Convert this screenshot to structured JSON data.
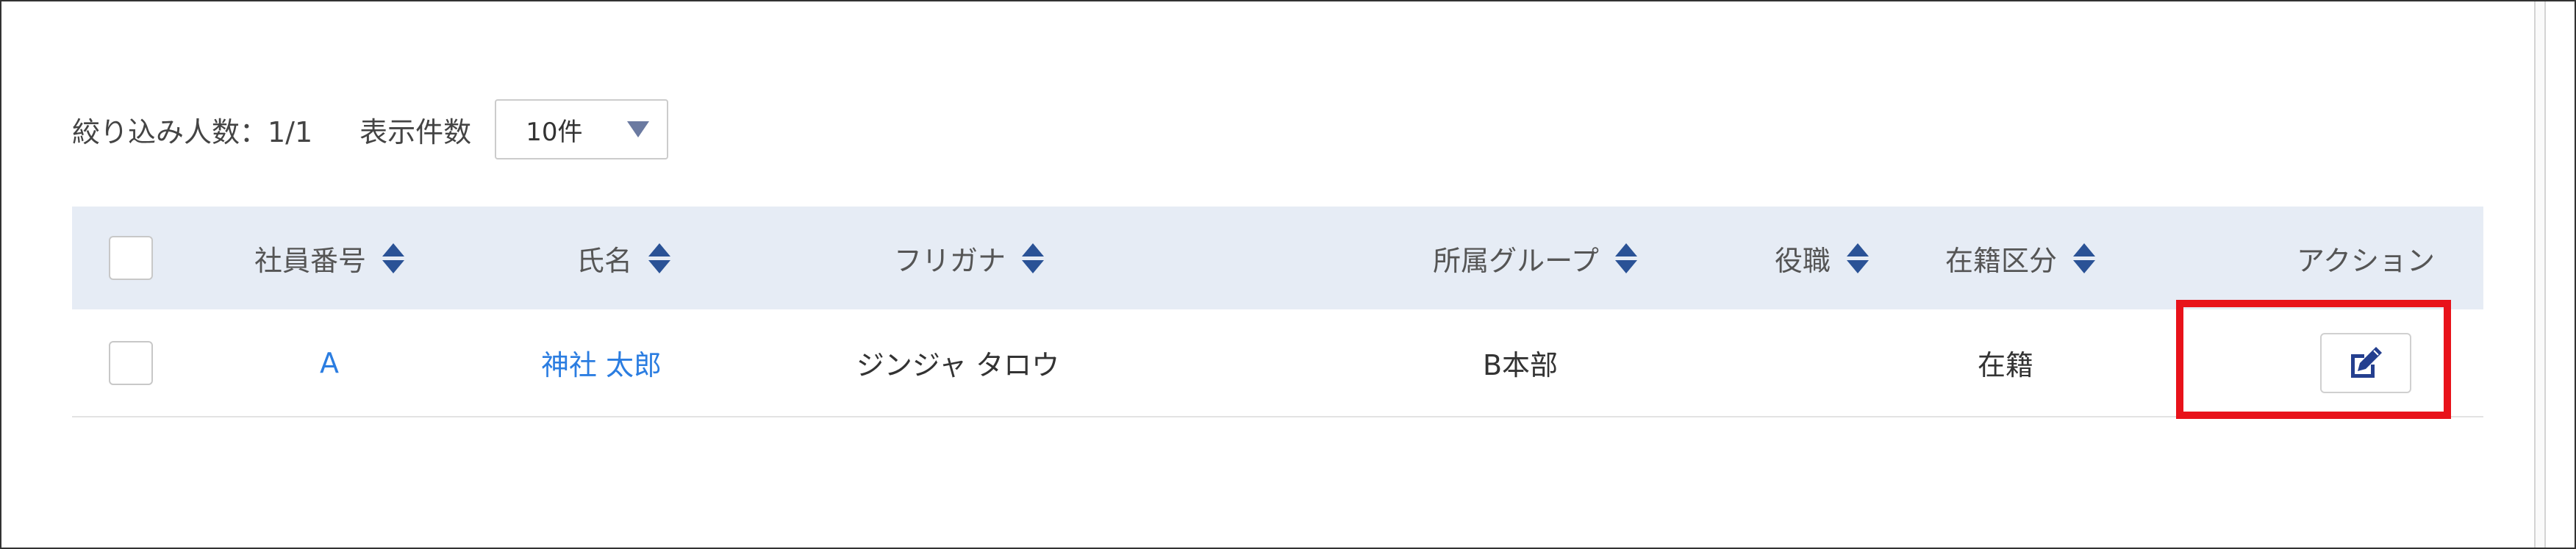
{
  "filter": {
    "count_text": "絞り込み人数：1/1",
    "page_size_label": "表示件数",
    "page_size_value": "10件"
  },
  "table": {
    "headers": {
      "employee_no": "社員番号",
      "name": "氏名",
      "furigana": "フリガナ",
      "group": "所属グループ",
      "position": "役職",
      "status": "在籍区分",
      "action": "アクション"
    },
    "rows": [
      {
        "employee_no": "A",
        "name": "神社 太郎",
        "furigana": "ジンジャ タロウ",
        "group": "B本部",
        "position": "",
        "status": "在籍"
      }
    ]
  },
  "icons": {
    "sort": "sort-icon",
    "edit": "edit-icon",
    "dropdown": "caret-down-icon"
  },
  "colors": {
    "header_bg": "#e6ecf5",
    "link": "#2b7de1",
    "sort_icon": "#2a5296",
    "highlight": "#e8121a"
  }
}
